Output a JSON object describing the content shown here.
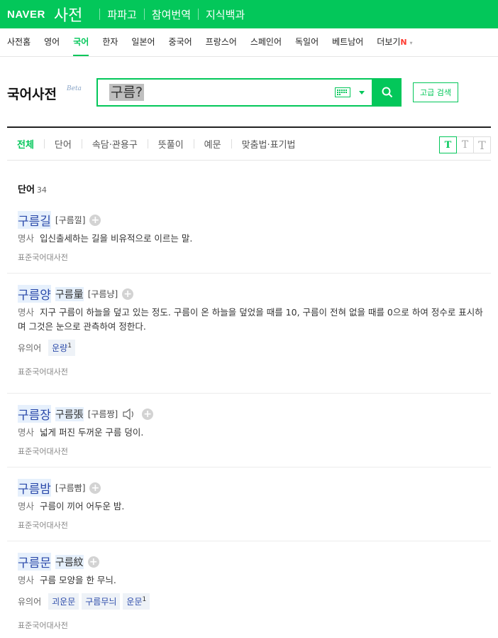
{
  "topbar": {
    "logo": "NAVER",
    "service": "사전",
    "links": [
      "파파고",
      "참여번역",
      "지식백과"
    ]
  },
  "langnav": {
    "items": [
      "사전홈",
      "영어",
      "국어",
      "한자",
      "일본어",
      "중국어",
      "프랑스어",
      "스페인어",
      "독일어",
      "베트남어"
    ],
    "active": "국어",
    "more_label": "더보기",
    "more_badge": "N"
  },
  "search": {
    "title": "국어사전",
    "beta": "Beta",
    "query": "구름?",
    "advanced_label": "고급 검색"
  },
  "tabs": {
    "items": [
      "전체",
      "단어",
      "속담·관용구",
      "뜻풀이",
      "예문",
      "맞춤법·표기법"
    ],
    "active": "전체",
    "font_sizes": [
      "T",
      "T",
      "T"
    ]
  },
  "results": {
    "section_label": "단어",
    "count": "34",
    "entries": [
      {
        "word": "구름길",
        "hanja": "",
        "pron": "[구름낄]",
        "pos": "명사",
        "definition": "입신출세하는 길을 비유적으로 이르는 말.",
        "source": "표준국어대사전"
      },
      {
        "word": "구름양",
        "hanja": "구름量",
        "pron": "[구름냥]",
        "pos": "명사",
        "definition": "지구 구름이 하늘을 덮고 있는 정도. 구름이 온 하늘을 덮었을 때를 10, 구름이 전혀 없을 때를 0으로 하여 정수로 표시하며 그것은 눈으로 관측하여 정한다.",
        "synonym_label": "유의어",
        "synonyms": [
          {
            "text": "운량",
            "sup": "1"
          }
        ],
        "source": "표준국어대사전"
      },
      {
        "word": "구름장",
        "hanja": "구름張",
        "pron": "[구름짱]",
        "pos": "명사",
        "definition": "넓게 퍼진 두꺼운 구름 덩이.",
        "source": "표준국어대사전"
      },
      {
        "word": "구름밤",
        "hanja": "",
        "pron": "[구름빰]",
        "pos": "명사",
        "definition": "구름이 끼어 어두운 밤.",
        "source": "표준국어대사전"
      },
      {
        "word": "구름문",
        "hanja": "구름紋",
        "pron": "",
        "pos": "명사",
        "definition": "구름 모양을 한 무늬.",
        "synonym_label": "유의어",
        "synonyms": [
          {
            "text": "괴운문",
            "sup": ""
          },
          {
            "text": "구름무늬",
            "sup": ""
          },
          {
            "text": "운문",
            "sup": "1"
          }
        ],
        "source": "표준국어대사전"
      }
    ]
  }
}
